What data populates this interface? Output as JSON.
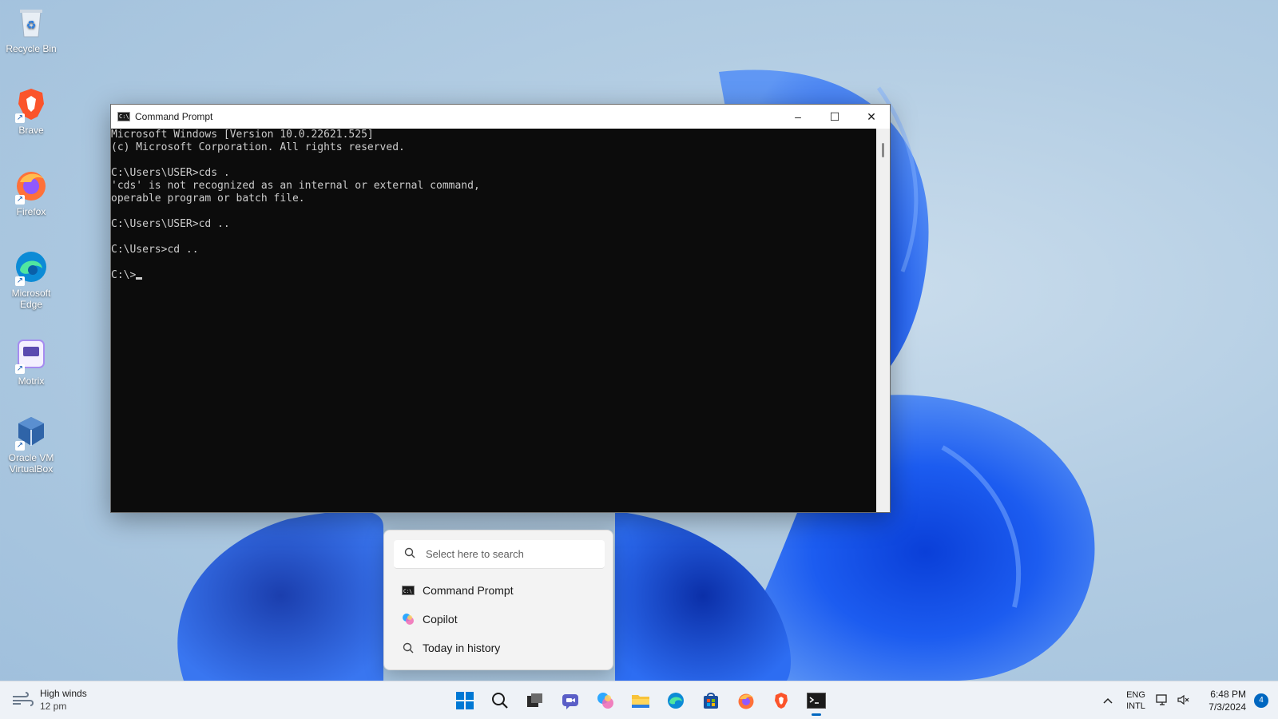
{
  "desktop": {
    "icons": [
      {
        "label": "Recycle Bin",
        "icon": "recycle-bin-icon"
      },
      {
        "label": "Brave",
        "icon": "brave-icon"
      },
      {
        "label": "Firefox",
        "icon": "firefox-icon"
      },
      {
        "label": "Microsoft Edge",
        "icon": "edge-icon"
      },
      {
        "label": "Motrix",
        "icon": "motrix-icon"
      },
      {
        "label": "Oracle VM VirtualBox",
        "icon": "virtualbox-icon"
      }
    ]
  },
  "cmd": {
    "title": "Command Prompt",
    "lines": [
      "Microsoft Windows [Version 10.0.22621.525]",
      "(c) Microsoft Corporation. All rights reserved.",
      "",
      "C:\\Users\\USER>cds .",
      "'cds' is not recognized as an internal or external command,",
      "operable program or batch file.",
      "",
      "C:\\Users\\USER>cd ..",
      "",
      "C:\\Users>cd ..",
      "",
      "C:\\>"
    ],
    "minimize": "–",
    "maximize": "☐",
    "close": "✕"
  },
  "search": {
    "placeholder": "Select here to search",
    "items": [
      {
        "label": "Command Prompt",
        "icon": "cmd-icon"
      },
      {
        "label": "Copilot",
        "icon": "copilot-icon"
      },
      {
        "label": "Today in history",
        "icon": "search-icon"
      }
    ]
  },
  "taskbar": {
    "weather": {
      "title": "High winds",
      "sub": "12 pm"
    },
    "apps": [
      "start",
      "search",
      "task-view",
      "chat",
      "copilot",
      "file-explorer",
      "edge",
      "store",
      "firefox",
      "brave",
      "terminal"
    ],
    "lang_top": "ENG",
    "lang_bottom": "INTL",
    "time": "6:48 PM",
    "date": "7/3/2024",
    "notifications": "4"
  },
  "colors": {
    "accent": "#0067c0",
    "terminal_bg": "#0c0c0c",
    "terminal_fg": "#cccccc"
  }
}
